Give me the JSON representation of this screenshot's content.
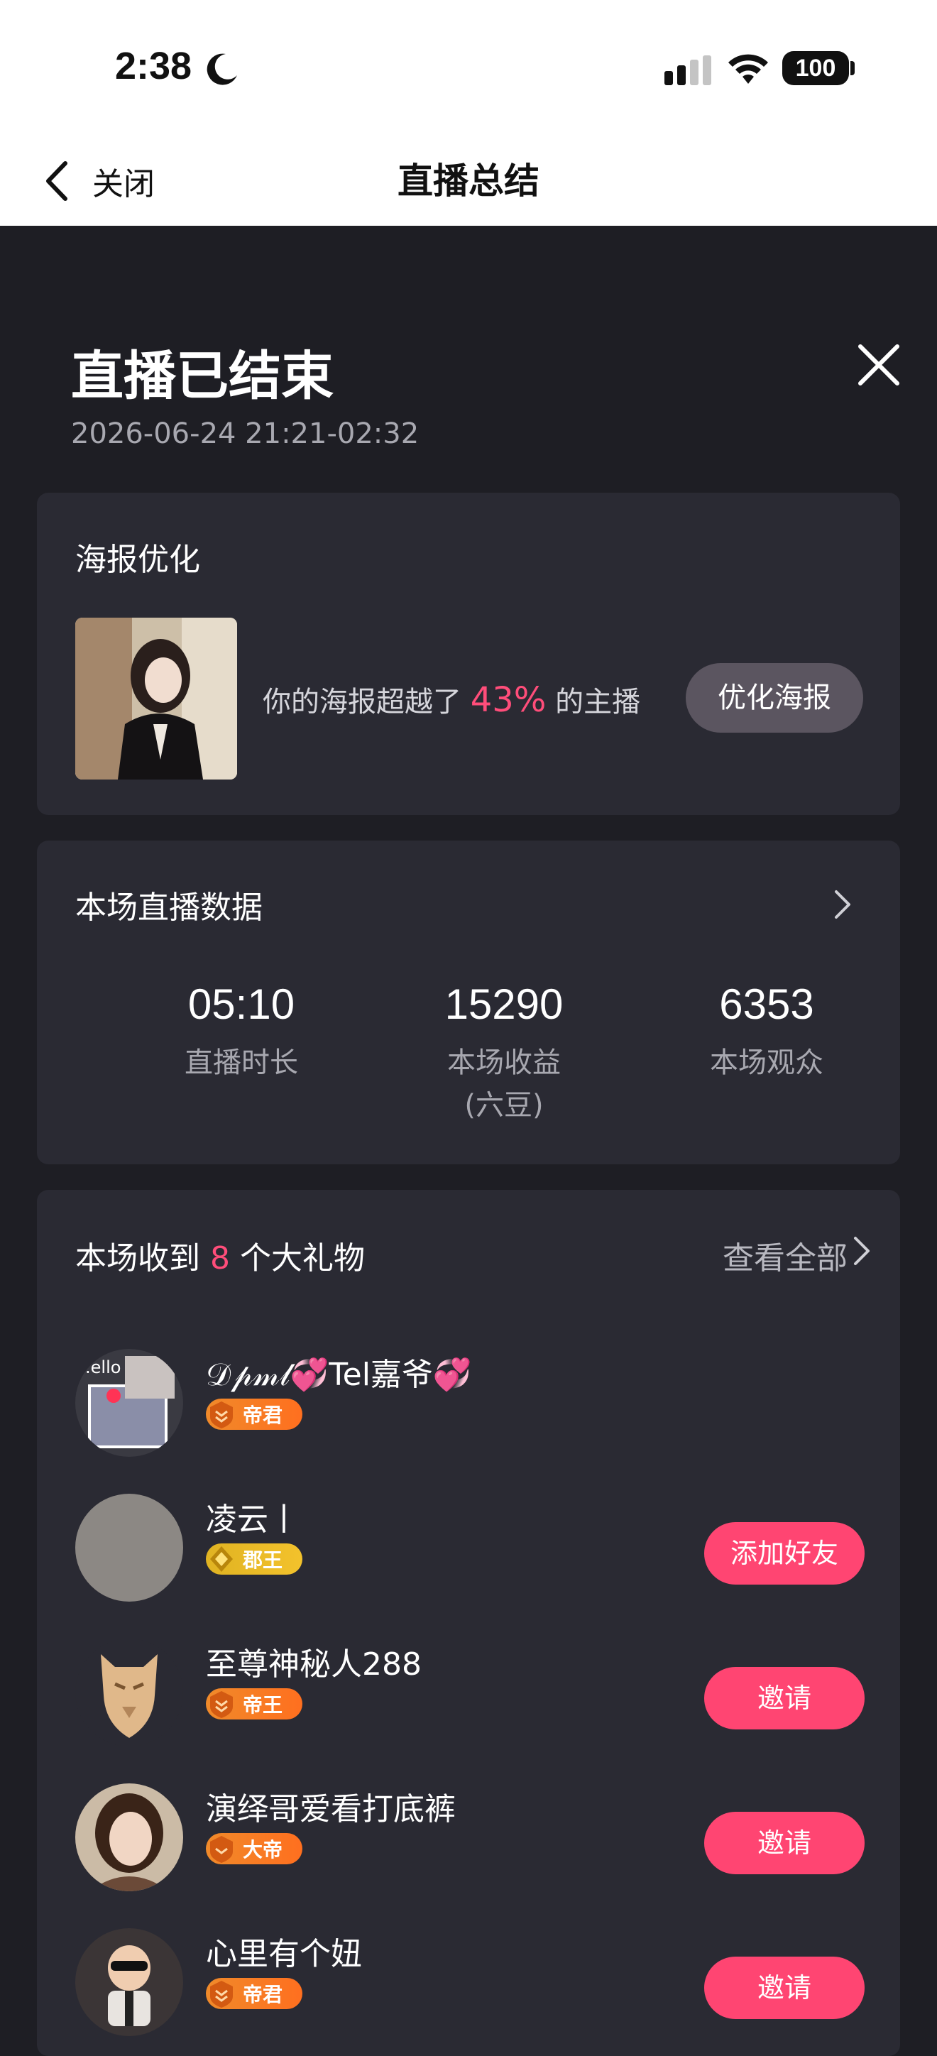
{
  "status_bar": {
    "time": "2:38",
    "battery": "100"
  },
  "nav": {
    "back_label": "关闭",
    "title": "直播总结"
  },
  "header": {
    "title": "直播已结束",
    "time_range": "2026-06-24 21:21-02:32"
  },
  "poster": {
    "title": "海报优化",
    "text_before": "你的海报超越了",
    "percent": "43%",
    "text_after": "的主播",
    "button": "优化海报"
  },
  "live_data": {
    "title": "本场直播数据",
    "stats": [
      {
        "value": "05:10",
        "label": "直播时长",
        "sublabel": ""
      },
      {
        "value": "15290",
        "label": "本场收益",
        "sublabel": "(六豆)"
      },
      {
        "value": "6353",
        "label": "本场观众",
        "sublabel": ""
      }
    ]
  },
  "gifts": {
    "title_before": "本场收到",
    "count": "8",
    "title_after": "个大礼物",
    "view_all": "查看全部",
    "users": [
      {
        "name": "𝒟𝓅𝓂𝓁💞Tel嘉爷💞",
        "badge": "帝君",
        "badge_color": "orange",
        "action": ""
      },
      {
        "name": "凌云丨",
        "badge": "郡王",
        "badge_color": "gold",
        "action": "添加好友"
      },
      {
        "name": "至尊神秘人288",
        "badge": "帝王",
        "badge_color": "orange",
        "action": "邀请"
      },
      {
        "name": "演绎哥爱看打底裤",
        "badge": "大帝",
        "badge_color": "orange",
        "action": "邀请"
      },
      {
        "name": "心里有个妞",
        "badge": "帝君",
        "badge_color": "orange",
        "action": "邀请"
      }
    ]
  },
  "colors": {
    "accent": "#ff4572",
    "highlight": "#ff4d7a",
    "background": "#1e1e24",
    "card": "#2a2a33"
  }
}
